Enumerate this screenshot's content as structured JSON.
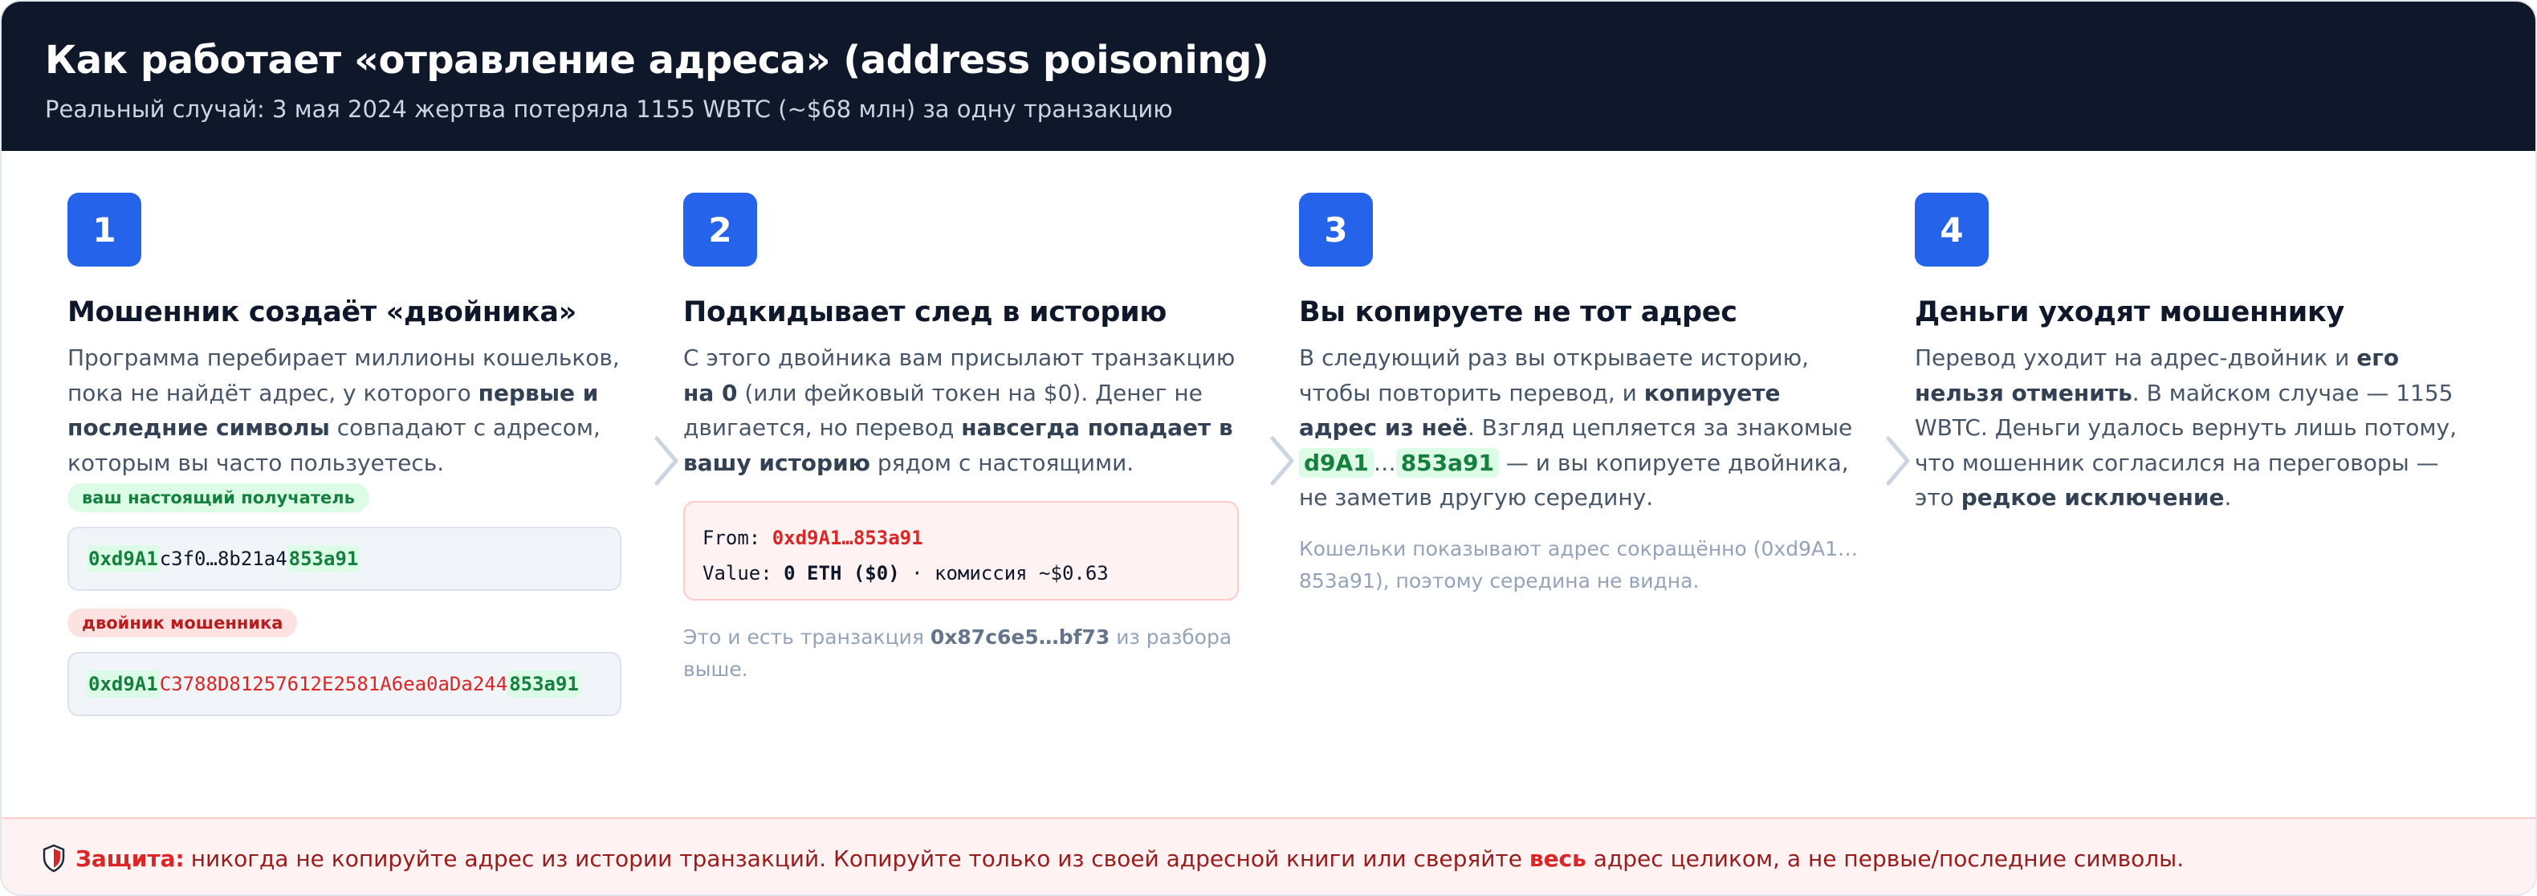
{
  "header": {
    "title": "Как работает «отравление адреса» (address poisoning)",
    "subtitle": "Реальный случай: 3 мая 2024 жертва потеряла 1155 WBTC (~$68 млн) за одну транзакцию"
  },
  "steps": [
    {
      "number": "1",
      "title": "Мошенник создаёт «двойника»",
      "body": {
        "t1": "Программа перебирает миллионы кошельков, пока не найдёт адрес, у которого ",
        "b1": "первые и последние символы",
        "t2": " совпадают с адресом, которым вы часто пользуетесь."
      },
      "real_label": "ваш настоящий получатель",
      "real_address": {
        "prefix": "0xd9A1",
        "middle": "c3f0…8b21a4",
        "suffix": "853a91"
      },
      "fake_label": "двойник мошенника",
      "fake_address": {
        "prefix": "0xd9A1",
        "middle": "C3788D81257612E2581A6ea0aDa244",
        "suffix": "853a91"
      }
    },
    {
      "number": "2",
      "title": "Подкидывает след в историю",
      "body": {
        "t1": "С этого двойника вам присылают транзакцию ",
        "b1": "на 0",
        "t2": " (или фейковый токен на $0). Денег не двигается, но перевод ",
        "b2": "навсегда попадает в вашу историю",
        "t3": " рядом с настоящими."
      },
      "tx": {
        "from_label": "From: ",
        "from_value": "0xd9A1…853a91",
        "value_label": "Value: ",
        "value_amount": "0 ETH ($0)",
        "value_rest": " · комиссия ~$0.63"
      },
      "note": {
        "t1": "Это и есть транзакция ",
        "b1": "0x87c6e5…bf73",
        "t2": " из разбора выше."
      }
    },
    {
      "number": "3",
      "title": "Вы копируете не тот адрес",
      "body": {
        "t1": "В следующий раз вы открываете историю, чтобы повторить перевод, и ",
        "b1": "копируете адрес из неё",
        "t2": ". Взгляд цепляется за знакомые ",
        "chip1": "d9A1",
        "ellipsis": "…",
        "chip2": "853a91",
        "t3": " — и вы копируете двойника, не заметив другую середину."
      },
      "note": "Кошельки показывают адрес сокращённо (0xd9A1…853a91), поэтому середина не видна."
    },
    {
      "number": "4",
      "title": "Деньги уходят мошеннику",
      "body": {
        "t1": "Перевод уходит на адрес-двойник и ",
        "b1": "его нельзя отменить",
        "t2": ". В майском случае — 1155 WBTC. Деньги удалось вернуть лишь потому, что мошенник согласился на переговоры — это ",
        "b2": "редкое исключение",
        "t3": "."
      }
    }
  ],
  "footer": {
    "lead": "Защита:",
    "t1": "никогда не копируйте адрес из истории транзакций. Копируйте только из своей адресной книги или сверяйте ",
    "b1": "весь",
    "t2": " адрес целиком, а не первые/последние символы."
  },
  "colors": {
    "header_bg": "#0f172a",
    "accent_blue": "#2563eb",
    "match_green": "#15803d",
    "danger_red": "#dc2626"
  }
}
